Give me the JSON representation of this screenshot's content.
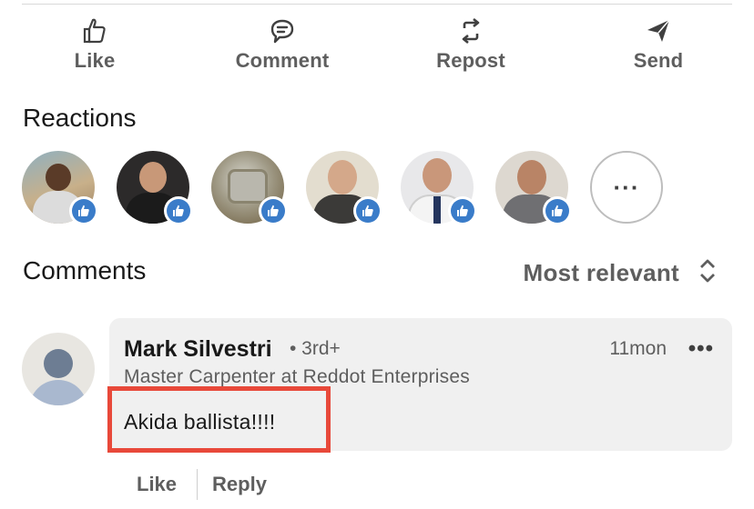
{
  "actions": {
    "like": {
      "label": "Like",
      "icon": "thumbs-up-outline-icon"
    },
    "comment": {
      "label": "Comment",
      "icon": "speech-bubble-icon"
    },
    "repost": {
      "label": "Repost",
      "icon": "repost-arrows-icon"
    },
    "send": {
      "label": "Send",
      "icon": "paper-plane-icon"
    }
  },
  "reactions": {
    "title": "Reactions",
    "reaction_type": "like",
    "badge_color": "#3a7cc9",
    "people_count_shown": 6,
    "more_label": "···"
  },
  "comments": {
    "title": "Comments",
    "sort_label": "Most relevant",
    "items": [
      {
        "author": "Mark Silvestri",
        "degree": "• 3rd+",
        "time": "11mon",
        "headline": "Master Carpenter at Reddot Enterprises",
        "text": "Akida ballista!!!!",
        "more_label": "•••",
        "like_label": "Like",
        "reply_label": "Reply"
      }
    ]
  },
  "colors": {
    "highlight_box": "#e8493a",
    "bubble_bg": "#f0f0f0",
    "secondary_text": "#5e5e5e"
  }
}
